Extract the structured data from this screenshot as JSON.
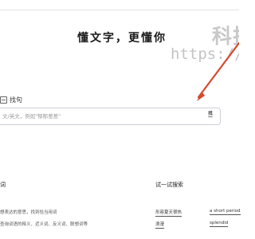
{
  "header": {
    "watermark_line1": "科技",
    "watermark_line2": "https://ww"
  },
  "hero": {
    "slogan": "懂文字，更懂你"
  },
  "search": {
    "tab_label": "找句",
    "placeholder": "文/英文，例如\"郁郁葱葱\"",
    "button_top": "找",
    "button_bottom": "一"
  },
  "sections": {
    "features_title": "词",
    "try_title": "试一试搜索"
  },
  "features": [
    "想表达的意思，找到恰当用词",
    "查询词语的释义、近义词、反义词、联想词等"
  ],
  "examples": [
    {
      "label": "形容夏天很热"
    },
    {
      "label": "a short period"
    },
    {
      "label": "浪漫"
    },
    {
      "label": "splendid"
    }
  ],
  "colors": {
    "arrow": "#d64a2e"
  }
}
